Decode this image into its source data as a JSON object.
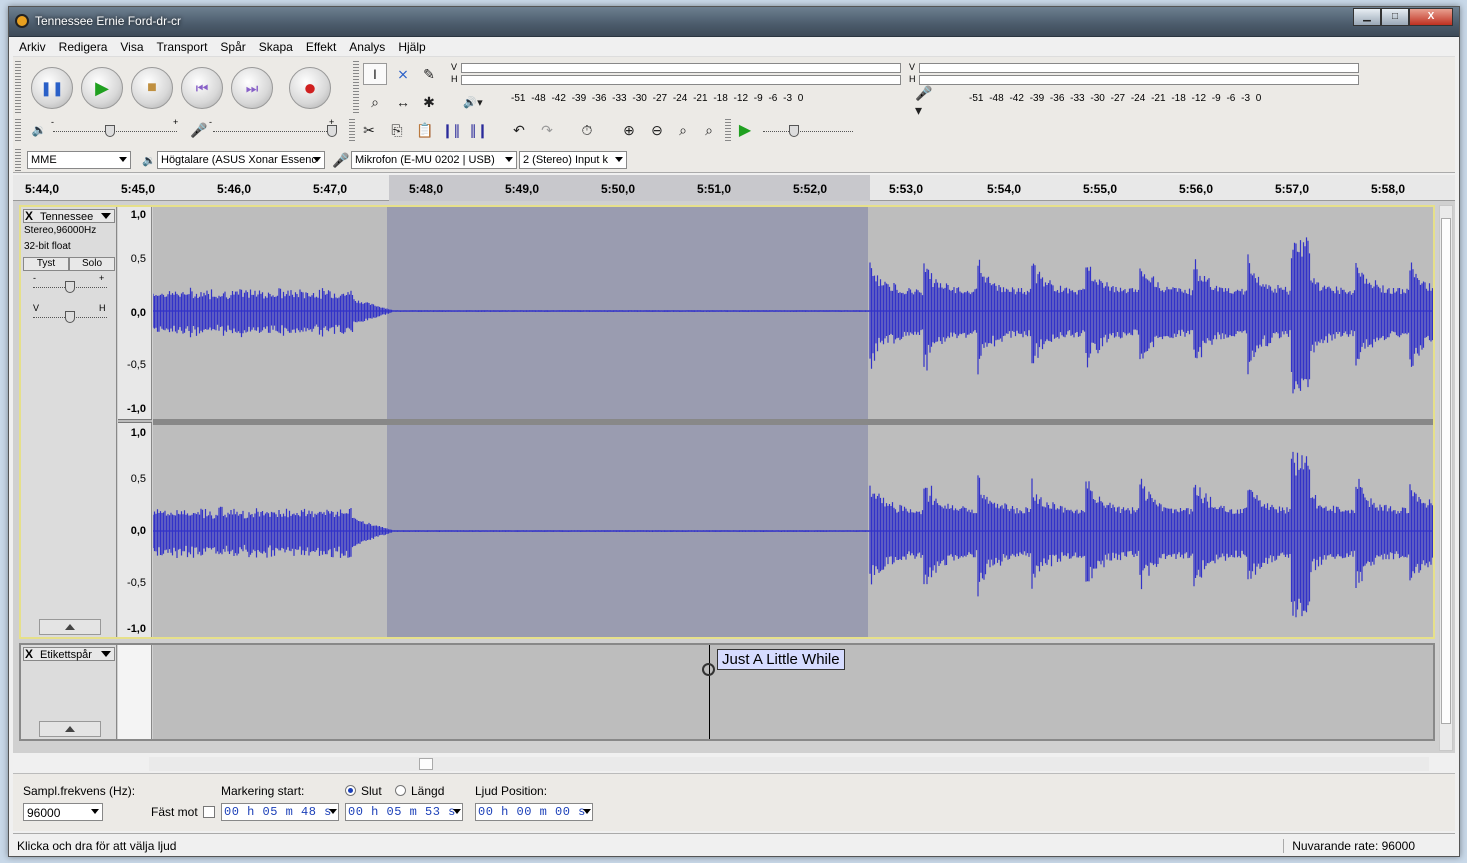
{
  "window": {
    "title": "Tennessee Ernie Ford-dr-cr",
    "min": "▁",
    "max": "□",
    "close": "X"
  },
  "menu": [
    "Arkiv",
    "Redigera",
    "Visa",
    "Transport",
    "Spår",
    "Skapa",
    "Effekt",
    "Analys",
    "Hjälp"
  ],
  "transport": {
    "pause": "❚❚",
    "play": "▶",
    "stop": "■",
    "skip_start": "⏮",
    "skip_end": "⏭",
    "record": "●"
  },
  "meters": {
    "playback": {
      "v": "V",
      "h": "H",
      "scale": "-51 -48   -42 -39 -36 -33 -30 -27 -24 -21 -18   -12 -9 -6 -3 0"
    },
    "record": {
      "v": "V",
      "h": "H",
      "scale": "-51 -48   -42 -39 -36 -33 -30 -27 -24 -21 -18   -12 -9 -6 -3 0"
    }
  },
  "mixer": {
    "out_min": "-",
    "out_max": "+",
    "in_min": "-",
    "in_max": "+"
  },
  "device": {
    "host": "MME",
    "output": "Högtalare (ASUS Xonar Essenc",
    "input": "Mikrofon (E-MU 0202 | USB)",
    "channels": "2 (Stereo) Input k"
  },
  "ruler": {
    "ticks": [
      "5:44,0",
      "5:45,0",
      "5:46,0",
      "5:47,0",
      "5:48,0",
      "5:49,0",
      "5:50,0",
      "5:51,0",
      "5:52,0",
      "5:53,0",
      "5:54,0",
      "5:55,0",
      "5:56,0",
      "5:57,0",
      "5:58,0"
    ]
  },
  "audio_track": {
    "close": "X",
    "name": "Tennessee",
    "format": "Stereo,96000Hz",
    "bitdepth": "32-bit float",
    "mute": "Tyst",
    "solo": "Solo",
    "gain_min": "-",
    "gain_max": "+",
    "pan_left": "V",
    "pan_right": "H",
    "scale": [
      "1,0",
      "0,5",
      "0,0",
      "-0,5",
      "-1,0"
    ]
  },
  "label_track": {
    "close": "X",
    "name": "Etikettspår",
    "label": "Just A Little While"
  },
  "selection_bar": {
    "rate_label": "Sampl.frekvens (Hz):",
    "rate_value": "96000",
    "snap_label": "Fäst mot",
    "start_label": "Markering start:",
    "end_label": "Slut",
    "length_label": "Längd",
    "position_label": "Ljud Position:",
    "start_value": "00 h 05 m 48 s",
    "end_value": "00 h 05 m 53 s",
    "position_value": "00 h 00 m 00 s"
  },
  "status": {
    "hint": "Klicka och dra för att välja ljud",
    "rate": "Nuvarande rate: 96000"
  },
  "colors": {
    "waveform": "#3232c8",
    "selection": "#9a9cb0",
    "track_border": "#e6e08a"
  }
}
